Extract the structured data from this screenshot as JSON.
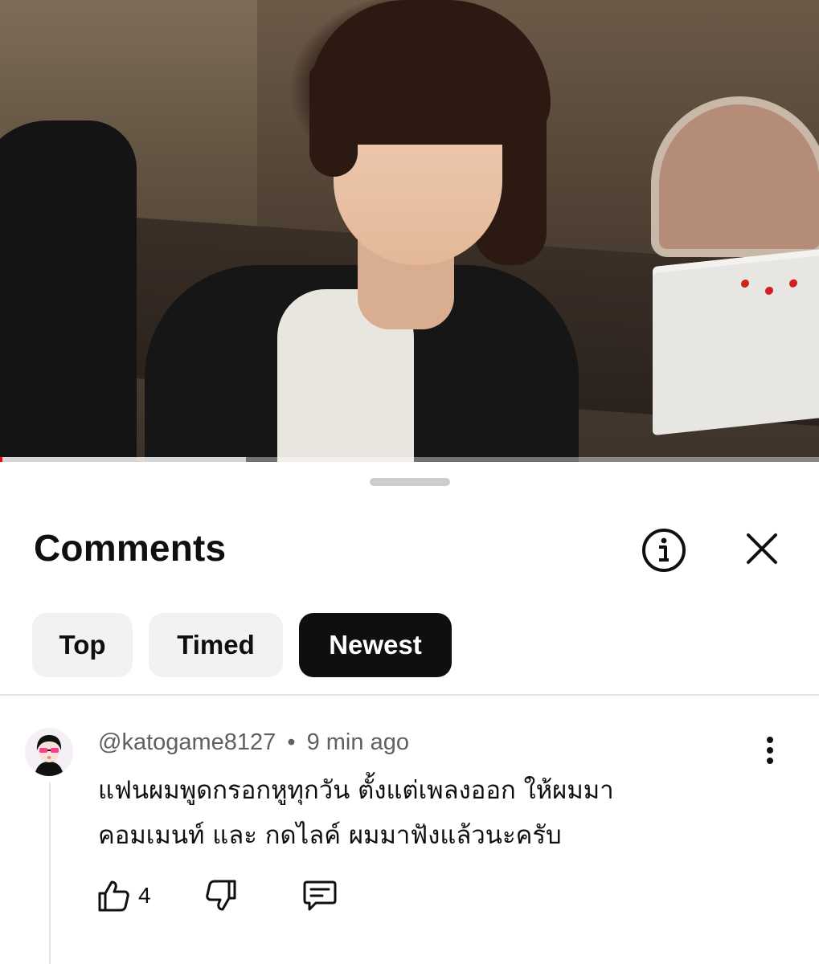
{
  "video": {
    "progress": 0.3
  },
  "panel": {
    "title": "Comments"
  },
  "filters": {
    "chips": [
      {
        "label": "Top"
      },
      {
        "label": "Timed"
      },
      {
        "label": "Newest"
      }
    ],
    "selected": "Newest"
  },
  "comment": {
    "author": "@katogame8127",
    "separator": "•",
    "time": "9 min ago",
    "text": "แฟนผมพูดกรอกหูทุกวัน ตั้งแต่เพลงออก ให้ผมมาคอมเมนท์ และ กดไลค์  ผมมาฟังแล้วนะครับ",
    "likes": "4"
  },
  "icons": {
    "info": "info-icon",
    "close": "close-icon",
    "more": "more-vertical-icon",
    "like": "thumbs-up-icon",
    "dislike": "thumbs-down-icon",
    "reply": "comment-reply-icon"
  },
  "colors": {
    "progress": "#ff0000",
    "chip_active_bg": "#0f0f0f",
    "chip_bg": "#f2f2f2",
    "secondary_text": "#606060"
  }
}
